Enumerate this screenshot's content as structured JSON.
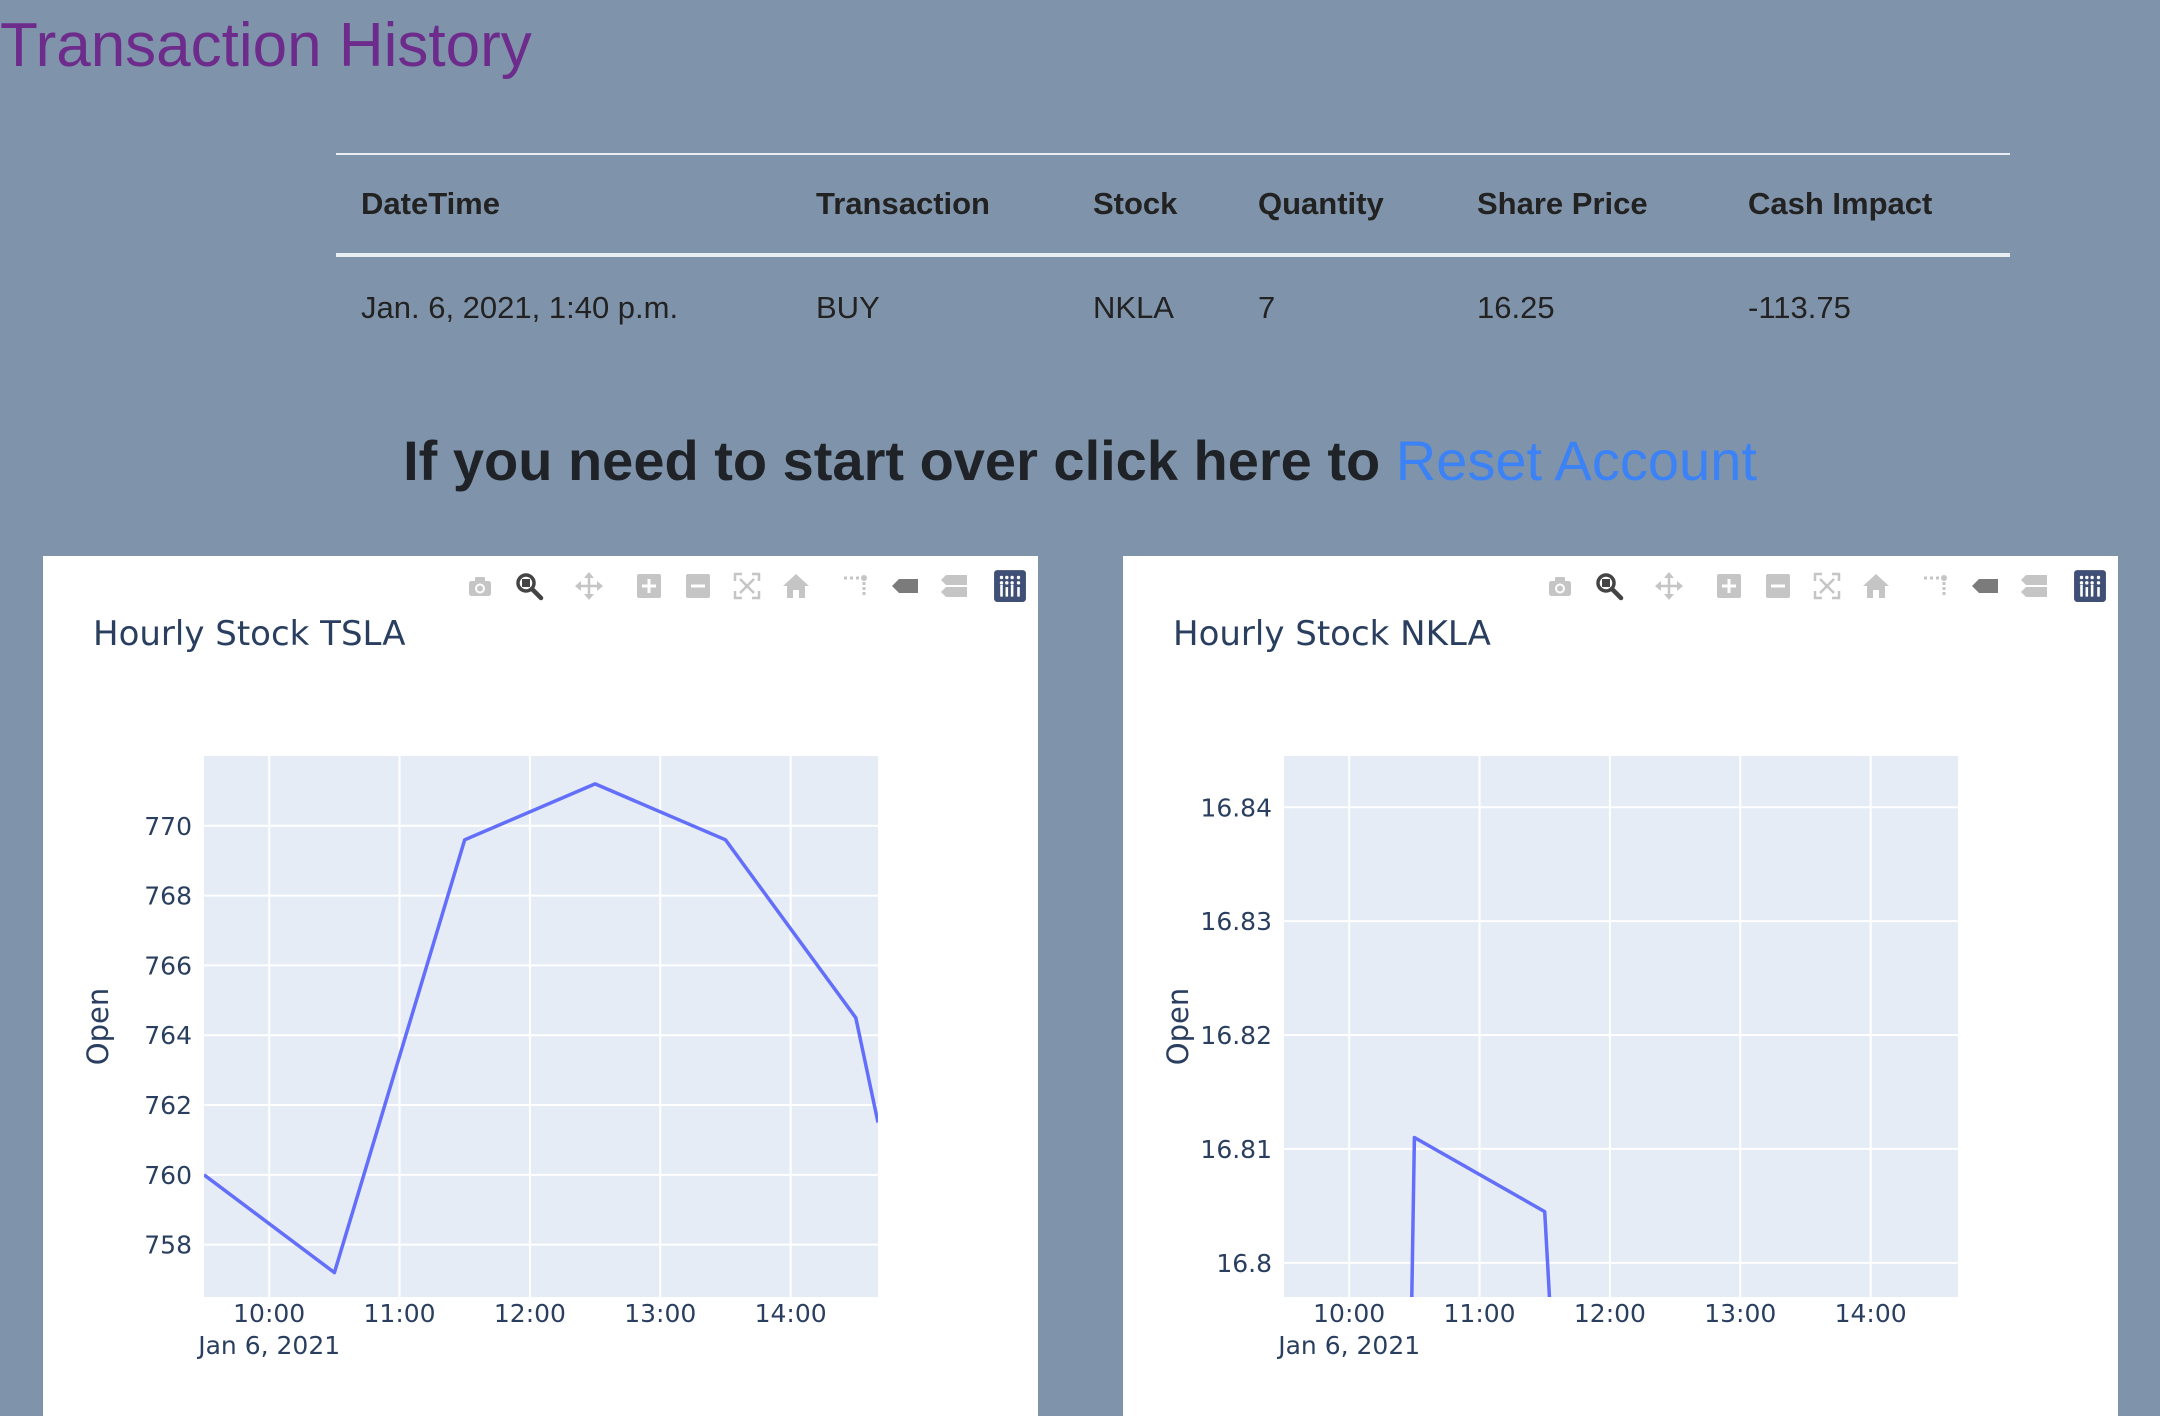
{
  "page": {
    "title": "Transaction History"
  },
  "table": {
    "headers": [
      "DateTime",
      "Transaction",
      "Stock",
      "Quantity",
      "Share Price",
      "Cash Impact"
    ],
    "rows": [
      [
        "Jan. 6, 2021, 1:40 p.m.",
        "BUY",
        "NKLA",
        "7",
        "16.25",
        "-113.75"
      ]
    ]
  },
  "reset": {
    "prefix": "If you need to start over click here to ",
    "link_label": "Reset Account"
  },
  "colors": {
    "page_bg": "#7f93aa",
    "title": "#6d2c8c",
    "link": "#3b82f6",
    "plot_bg": "#e5ecf6",
    "line": "#636efa"
  },
  "modebar_icons": [
    "camera-icon",
    "zoom-icon",
    "pan-icon",
    "zoom-in-icon",
    "zoom-out-icon",
    "autoscale-icon",
    "reset-axes-icon",
    "spike-lines-icon",
    "hover-closest-icon",
    "hover-compare-icon",
    "plotly-logo-icon"
  ],
  "chart_data": [
    {
      "type": "line",
      "title": "Hourly Stock TSLA",
      "xlabel": "",
      "ylabel": "Open",
      "x_ticks": [
        "10:00",
        "11:00",
        "12:00",
        "13:00",
        "14:00"
      ],
      "x_tick_values": [
        10,
        11,
        12,
        13,
        14
      ],
      "x_date_label": "Jan 6, 2021",
      "xlim": [
        9.5,
        14.67
      ],
      "y_ticks": [
        758,
        760,
        762,
        764,
        766,
        768,
        770
      ],
      "ylim": [
        756.5,
        772
      ],
      "grid": true,
      "series": [
        {
          "x": [
            9.5,
            10.5,
            11.5,
            12.5,
            13.5,
            14.5,
            14.67
          ],
          "y": [
            760.0,
            757.2,
            769.6,
            771.2,
            769.6,
            764.5,
            761.5
          ]
        }
      ]
    },
    {
      "type": "line",
      "title": "Hourly Stock NKLA",
      "xlabel": "",
      "ylabel": "Open",
      "x_ticks": [
        "10:00",
        "11:00",
        "12:00",
        "13:00",
        "14:00"
      ],
      "x_tick_values": [
        10,
        11,
        12,
        13,
        14
      ],
      "x_date_label": "Jan 6, 2021",
      "xlim": [
        9.5,
        14.67
      ],
      "y_ticks": [
        "16.8",
        "16.81",
        "16.82",
        "16.83",
        "16.84"
      ],
      "y_tick_values": [
        16.8,
        16.81,
        16.82,
        16.83,
        16.84
      ],
      "ylim": [
        16.797,
        16.8445
      ],
      "grid": true,
      "series": [
        {
          "x": [
            10.47,
            10.5,
            11.5,
            11.57
          ],
          "y": [
            16.79,
            16.811,
            16.8045,
            16.79
          ]
        }
      ]
    }
  ]
}
